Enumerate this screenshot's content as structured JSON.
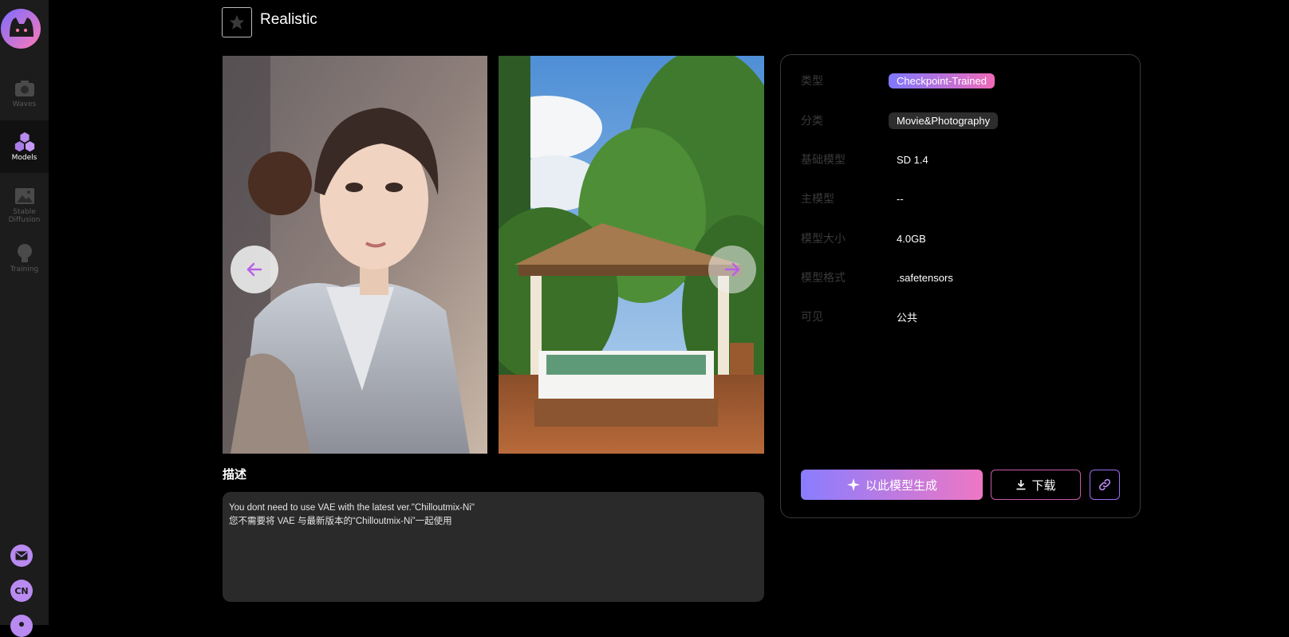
{
  "sidebar": {
    "items": [
      {
        "label": "Waves",
        "icon": "camera-icon",
        "active": false
      },
      {
        "label": "Models",
        "icon": "cubes-icon",
        "active": true
      },
      {
        "label": "Stable Diffusion",
        "icon": "image-icon",
        "active": false
      },
      {
        "label": "Training",
        "icon": "lightbulb-icon",
        "active": false
      }
    ],
    "bottom": [
      {
        "icon": "mail-icon"
      },
      {
        "icon": "language-icon",
        "text": "CN"
      },
      {
        "icon": "user-icon"
      }
    ]
  },
  "header": {
    "title": "Realistic"
  },
  "description": {
    "title": "描述",
    "line1": "You dont need to use VAE with the latest ver.\"Chilloutmix-Ni\"",
    "line2": "您不需要将 VAE 与最新版本的“Chilloutmix-Ni”一起使用"
  },
  "info": {
    "rows": [
      {
        "label": "类型",
        "value": "Checkpoint-Trained"
      },
      {
        "label": "分类",
        "value": "Movie&Photography"
      },
      {
        "label": "基础模型",
        "value": "SD 1.4"
      },
      {
        "label": "主模型",
        "value": "--"
      },
      {
        "label": "模型大小",
        "value": "4.0GB"
      },
      {
        "label": "模型格式",
        "value": ".safetensors"
      },
      {
        "label": "可见",
        "value": "公共"
      }
    ]
  },
  "actions": {
    "generate_label": "以此模型生成",
    "download_label": "下载"
  },
  "colors": {
    "accent_start": "#8a7dff",
    "accent_end": "#ee77c4",
    "arrow": "#b860e8"
  }
}
